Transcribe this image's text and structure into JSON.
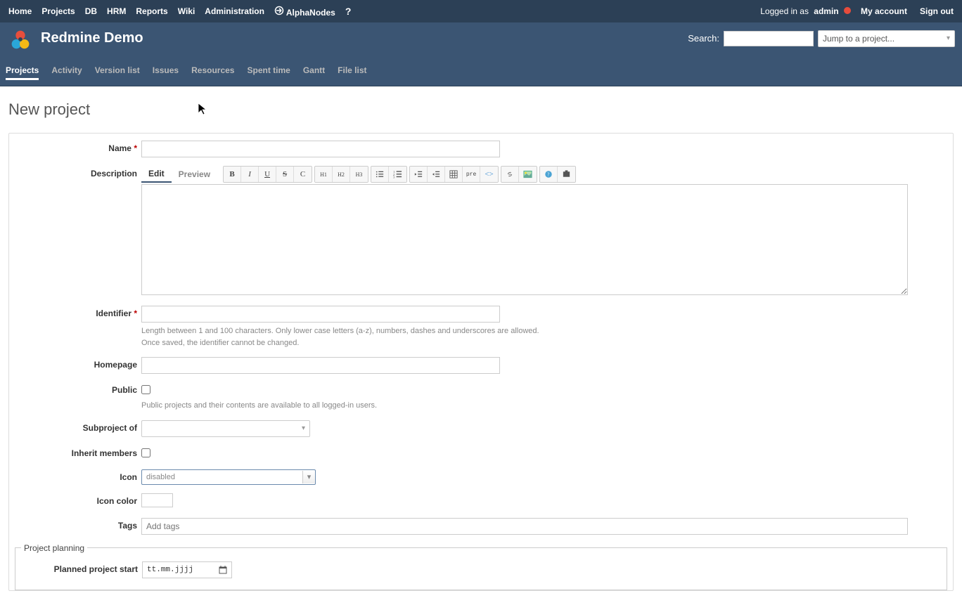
{
  "topmenu": {
    "left": [
      "Home",
      "Projects",
      "DB",
      "HRM",
      "Reports",
      "Wiki",
      "Administration"
    ],
    "alphanodes": "AlphaNodes",
    "logged_in_as": "Logged in as",
    "username": "admin",
    "my_account": "My account",
    "sign_out": "Sign out"
  },
  "header": {
    "title": "Redmine Demo",
    "search_label": "Search:",
    "jump_placeholder": "Jump to a project..."
  },
  "mainmenu": [
    "Projects",
    "Activity",
    "Version list",
    "Issues",
    "Resources",
    "Spent time",
    "Gantt",
    "File list"
  ],
  "selected_menu_index": 0,
  "page_title": "New project",
  "form": {
    "name_label": "Name",
    "name_value": "",
    "description_label": "Description",
    "tab_edit": "Edit",
    "tab_preview": "Preview",
    "description_value": "",
    "identifier_label": "Identifier",
    "identifier_value": "",
    "identifier_hint1": "Length between 1 and 100 characters. Only lower case letters (a-z), numbers, dashes and underscores are allowed.",
    "identifier_hint2": "Once saved, the identifier cannot be changed.",
    "homepage_label": "Homepage",
    "homepage_value": "",
    "public_label": "Public",
    "public_checked": false,
    "public_hint": "Public projects and their contents are available to all logged-in users.",
    "subproject_label": "Subproject of",
    "subproject_value": "",
    "inherit_label": "Inherit members",
    "inherit_checked": false,
    "icon_label": "Icon",
    "icon_value": "disabled",
    "iconcolor_label": "Icon color",
    "iconcolor_value": "#000000",
    "tags_label": "Tags",
    "tags_placeholder": "Add tags",
    "planning_legend": "Project planning",
    "planned_start_label": "Planned project start",
    "planned_start_placeholder": "tt.mm.jjjj"
  },
  "toolbar_icons": [
    "bold",
    "italic",
    "underline",
    "strikethrough",
    "inline-code",
    "h1",
    "h2",
    "h3",
    "ul",
    "ol",
    "outdent",
    "indent",
    "table",
    "pre",
    "code-block",
    "link",
    "image",
    "help",
    "more"
  ]
}
